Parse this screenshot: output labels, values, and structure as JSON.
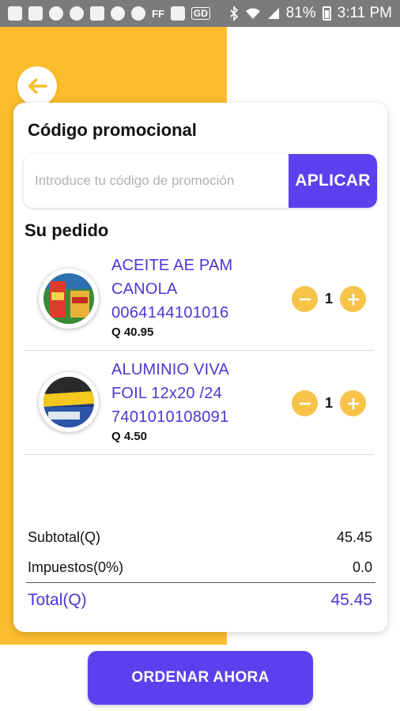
{
  "status_bar": {
    "battery": "81%",
    "time": "3:11 PM",
    "left_icons": [
      "message-icon",
      "facebook-icon",
      "messenger-icon",
      "messenger-icon",
      "image-icon",
      "whatsapp-icon",
      "play-icon",
      "ff-icon",
      "clipboard-icon",
      "gd-icon"
    ],
    "ff_label": "FF",
    "gd_label": "GD"
  },
  "colors": {
    "accent": "#5b41ee",
    "brand_yellow": "#fbbd2d",
    "link_text": "#4b36d6"
  },
  "promo": {
    "title": "Código promocional",
    "placeholder": "Introduce tu código de promoción",
    "value": "",
    "apply_label": "APLICAR"
  },
  "order": {
    "title": "Su pedido",
    "items": [
      {
        "name": "ACEITE AE PAM CANOLA",
        "code": "0064144101016",
        "price": "Q 40.95",
        "quantity": "1"
      },
      {
        "name": "ALUMINIO VIVA FOIL 12x20 /24",
        "code": "7401010108091",
        "price": "Q 4.50",
        "quantity": "1"
      }
    ]
  },
  "summary": {
    "subtotal_label": "Subtotal(Q)",
    "subtotal_value": "45.45",
    "tax_label": "Impuestos(0%)",
    "tax_value": "0.0",
    "total_label": "Total(Q)",
    "total_value": "45.45"
  },
  "cta": {
    "label": "ORDENAR AHORA"
  }
}
